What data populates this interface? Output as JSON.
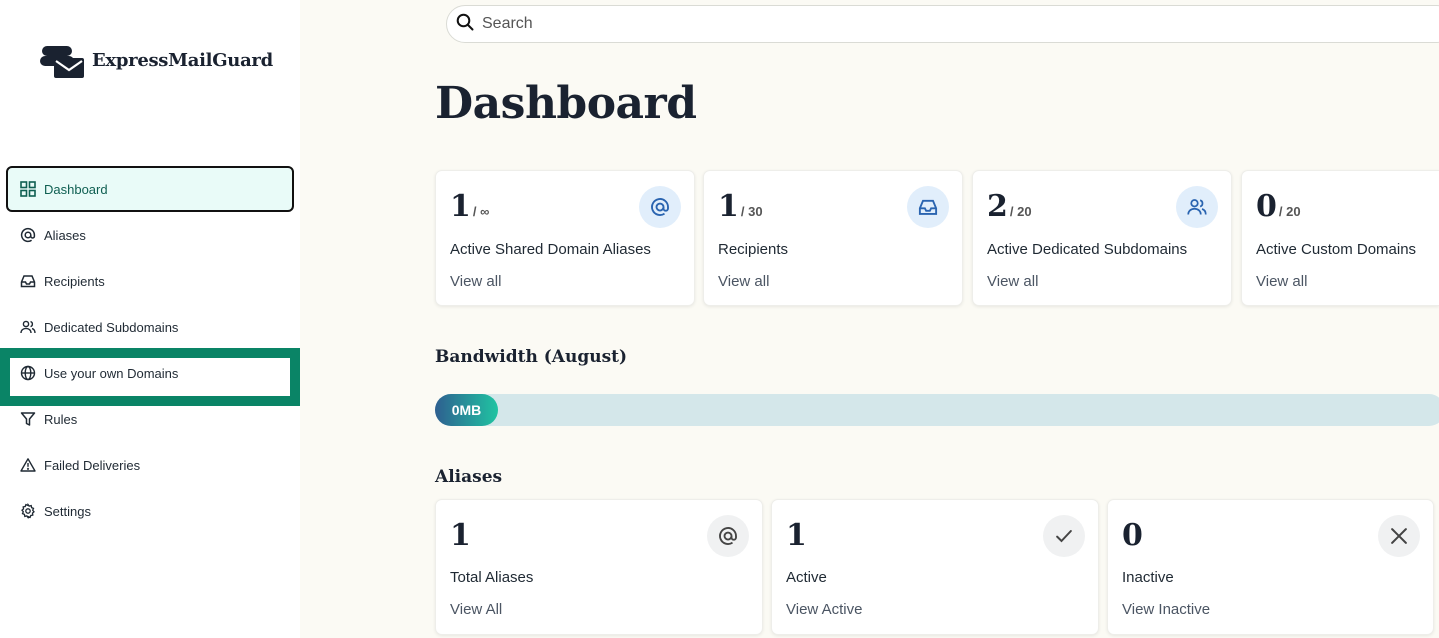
{
  "app": {
    "name": "ExpressMailGuard"
  },
  "sidebar": {
    "items": [
      {
        "label": "Dashboard",
        "icon": "grid-icon",
        "active": true
      },
      {
        "label": "Aliases",
        "icon": "at-icon"
      },
      {
        "label": "Recipients",
        "icon": "inbox-icon"
      },
      {
        "label": "Dedicated Subdomains",
        "icon": "users-icon"
      },
      {
        "label": "Use your own Domains",
        "icon": "globe-icon",
        "highlighted": true
      },
      {
        "label": "Rules",
        "icon": "filter-icon"
      },
      {
        "label": "Failed Deliveries",
        "icon": "warning-icon"
      },
      {
        "label": "Settings",
        "icon": "gear-icon"
      }
    ]
  },
  "search": {
    "placeholder": "Search"
  },
  "page": {
    "title": "Dashboard"
  },
  "stats": [
    {
      "value": "1",
      "limit": "/ ∞",
      "label": "Active Shared Domain Aliases",
      "link": "View all",
      "icon": "at-icon"
    },
    {
      "value": "1",
      "limit": "/ 30",
      "label": "Recipients",
      "link": "View all",
      "icon": "inbox-icon"
    },
    {
      "value": "2",
      "limit": "/ 20",
      "label": "Active Dedicated Subdomains",
      "link": "View all",
      "icon": "users-icon"
    },
    {
      "value": "0",
      "limit": "/ 20",
      "label": "Active Custom Domains",
      "link": "View all",
      "icon": "globe-icon"
    }
  ],
  "bandwidth": {
    "title": "Bandwidth (August)",
    "used_label": "0MB",
    "used_fraction": 0
  },
  "aliases": {
    "title": "Aliases",
    "cards": [
      {
        "value": "1",
        "label": "Total Aliases",
        "link": "View All",
        "icon": "at-icon"
      },
      {
        "value": "1",
        "label": "Active",
        "link": "View Active",
        "icon": "check-icon"
      },
      {
        "value": "0",
        "label": "Inactive",
        "link": "View Inactive",
        "icon": "close-icon"
      }
    ]
  },
  "colors": {
    "accent": "#0a8466",
    "active_bg": "#e9fbf8",
    "bar_track": "#d4e7ea",
    "bar_start": "#2e5f90",
    "bar_end": "#20c4a2"
  }
}
